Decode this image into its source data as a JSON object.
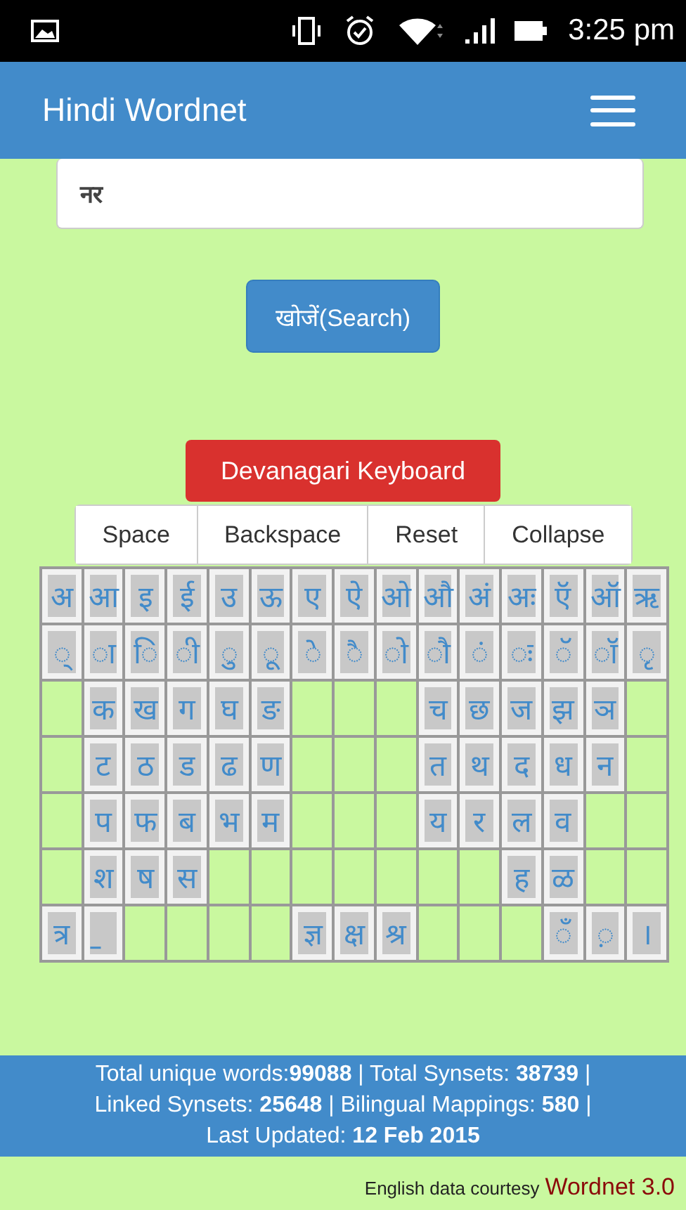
{
  "status_bar": {
    "time": "3:25 pm"
  },
  "header": {
    "title": "Hindi Wordnet"
  },
  "search": {
    "value": "नर",
    "button": "खोजें(Search)"
  },
  "keyboard": {
    "toggle": "Devanagari Keyboard",
    "actions": [
      "Space",
      "Backspace",
      "Reset",
      "Collapse"
    ],
    "rows": [
      [
        "अ",
        "आ",
        "इ",
        "ई",
        "उ",
        "ऊ",
        "ए",
        "ऐ",
        "ओ",
        "औ",
        "अं",
        "अः",
        "ऍ",
        "ऑ",
        "ऋ"
      ],
      [
        "◌्",
        "◌ा",
        "◌ि",
        "◌ी",
        "◌ु",
        "◌ू",
        "◌े",
        "◌ै",
        "◌ो",
        "◌ौ",
        "◌ं",
        "◌ः",
        "◌ॅ",
        "◌ॉ",
        "◌ृ"
      ],
      [
        null,
        "क",
        "ख",
        "ग",
        "घ",
        "ङ",
        null,
        null,
        null,
        "च",
        "छ",
        "ज",
        "झ",
        "ञ",
        null
      ],
      [
        null,
        "ट",
        "ठ",
        "ड",
        "ढ",
        "ण",
        null,
        null,
        null,
        "त",
        "थ",
        "द",
        "ध",
        "न",
        null
      ],
      [
        null,
        "प",
        "फ",
        "ब",
        "भ",
        "म",
        null,
        null,
        null,
        "य",
        "र",
        "ल",
        "व",
        null,
        null
      ],
      [
        null,
        "श",
        "ष",
        "स",
        null,
        null,
        null,
        null,
        null,
        null,
        null,
        "ह",
        "ळ",
        null,
        null
      ],
      [
        "त्र",
        "॒",
        null,
        null,
        null,
        null,
        "ज्ञ",
        "क्ष",
        "श्र",
        null,
        null,
        null,
        "◌ँ",
        "◌़",
        "।"
      ]
    ]
  },
  "stats": "Total unique words:**99088** | Total Synsets: **38739** | Linked Synsets: **25648** | Bilingual Mappings: **580** | Last Updated: **12 Feb 2015**",
  "credit": {
    "text": "English data courtesy",
    "link": "Wordnet 3.0"
  }
}
